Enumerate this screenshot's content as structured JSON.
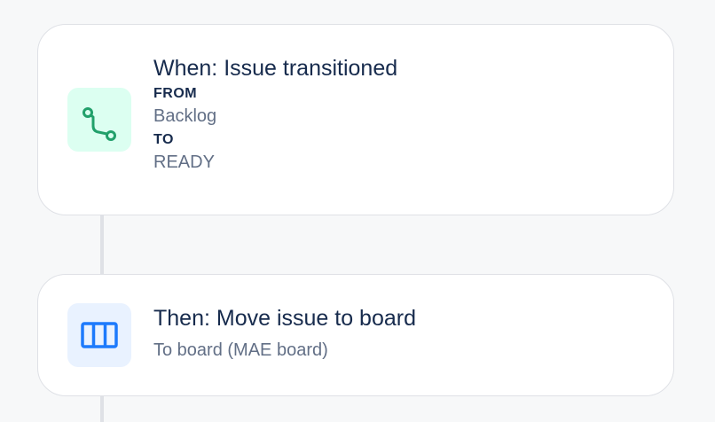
{
  "trigger": {
    "title": "When: Issue transitioned",
    "from_label": "FROM",
    "from_value": "Backlog",
    "to_label": "TO",
    "to_value": "READY",
    "icon": "transition-icon",
    "icon_color": "#22a06b",
    "icon_bg": "#dcfff1"
  },
  "action": {
    "title": "Then: Move issue to board",
    "subtitle": "To board (MAE board)",
    "icon": "board-columns-icon",
    "icon_color": "#1d7afc",
    "icon_bg": "#e9f2ff"
  }
}
